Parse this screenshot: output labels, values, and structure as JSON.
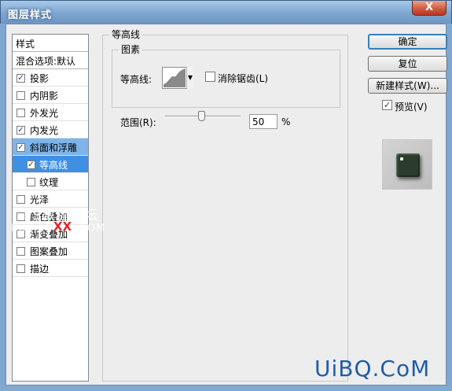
{
  "window": {
    "title": "图层样式",
    "close_glyph": "X"
  },
  "style_list": {
    "header": "样式",
    "blend_options": "混合选项:默认",
    "items": [
      {
        "label": "投影",
        "checked": true
      },
      {
        "label": "内阴影",
        "checked": false
      },
      {
        "label": "外发光",
        "checked": false
      },
      {
        "label": "内发光",
        "checked": true
      },
      {
        "label": "斜面和浮雕",
        "checked": true
      },
      {
        "label": "等高线",
        "checked": true
      },
      {
        "label": "纹理",
        "checked": false
      },
      {
        "label": "光泽",
        "checked": false
      },
      {
        "label": "颜色叠加",
        "checked": false
      },
      {
        "label": "渐变叠加",
        "checked": false
      },
      {
        "label": "图案叠加",
        "checked": false
      },
      {
        "label": "描边",
        "checked": false
      }
    ]
  },
  "panel": {
    "group_title": "等高线",
    "subgroup_title": "图素",
    "contour_label": "等高线:",
    "anti_alias_label": "消除锯齿(L)",
    "anti_alias_checked": false,
    "range_label": "范围(R):",
    "range_value": "50",
    "range_fraction": 0.5,
    "range_unit": "%"
  },
  "buttons": {
    "ok": "确定",
    "reset": "复位",
    "new_style": "新建样式(W)...",
    "preview_label": "预览(V)",
    "preview_checked": true
  },
  "watermarks": {
    "line1": "PS教程论坛",
    "line2": "BBS.16XX8.COM",
    "line3": "XX",
    "corner": "UiBQ.CoM"
  },
  "colors": {
    "selected_row": "#7eb4ea",
    "active_row": "#3f8fe3",
    "titlebar": "#7ea6d0",
    "close_button": "#cf5a43"
  }
}
